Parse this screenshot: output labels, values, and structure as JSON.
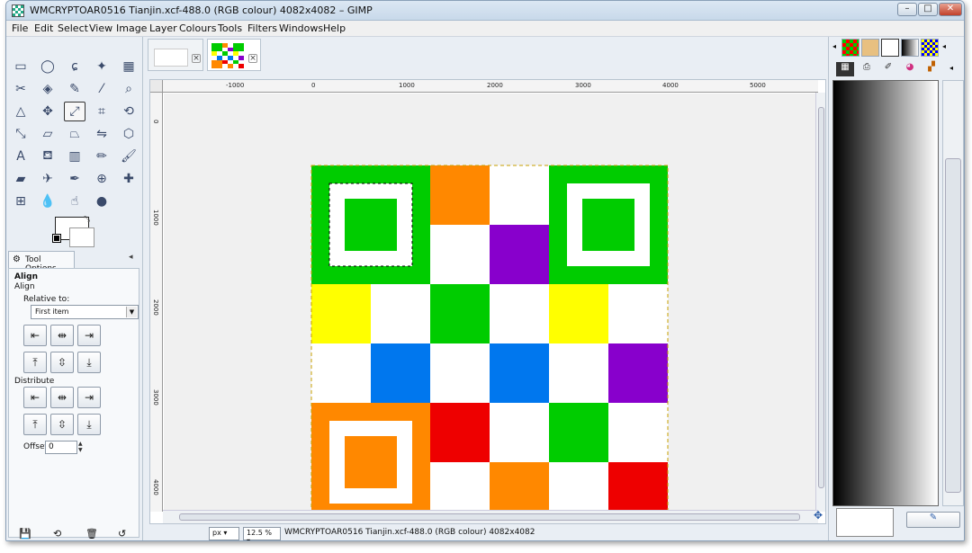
{
  "window": {
    "title": "WMCRYPTOAR0516 Tianjin.xcf-488.0 (RGB colour) 4082x4082 – GIMP",
    "min_label": "–",
    "max_label": "□",
    "close_label": "✕"
  },
  "menu": {
    "items": [
      "File",
      "Edit",
      "Select",
      "View",
      "Image",
      "Layer",
      "Colours",
      "Tools",
      "Filters",
      "Windows",
      "Help"
    ]
  },
  "toolbox": {
    "tools": [
      {
        "name": "rect-select",
        "glyph": "▭"
      },
      {
        "name": "ellipse-select",
        "glyph": "◯"
      },
      {
        "name": "free-select",
        "glyph": "ɕ"
      },
      {
        "name": "fuzzy-select",
        "glyph": "✦"
      },
      {
        "name": "select-by-color",
        "glyph": "▦"
      },
      {
        "name": "scissors-select",
        "glyph": "✂"
      },
      {
        "name": "foreground-select",
        "glyph": "◈"
      },
      {
        "name": "paths",
        "glyph": "✎"
      },
      {
        "name": "color-picker",
        "glyph": "⁄"
      },
      {
        "name": "zoom",
        "glyph": "⌕"
      },
      {
        "name": "measure",
        "glyph": "△"
      },
      {
        "name": "move",
        "glyph": "✥"
      },
      {
        "name": "align",
        "glyph": "⤢"
      },
      {
        "name": "crop",
        "glyph": "⌗"
      },
      {
        "name": "rotate",
        "glyph": "⟲"
      },
      {
        "name": "scale",
        "glyph": "⤡"
      },
      {
        "name": "shear",
        "glyph": "▱"
      },
      {
        "name": "perspective",
        "glyph": "⏢"
      },
      {
        "name": "flip",
        "glyph": "⇋"
      },
      {
        "name": "cage",
        "glyph": "⬡"
      },
      {
        "name": "text",
        "glyph": "A"
      },
      {
        "name": "bucket-fill",
        "glyph": "⛾"
      },
      {
        "name": "blend",
        "glyph": "▥"
      },
      {
        "name": "pencil",
        "glyph": "✏"
      },
      {
        "name": "paintbrush",
        "glyph": "🖌"
      },
      {
        "name": "eraser",
        "glyph": "▰"
      },
      {
        "name": "airbrush",
        "glyph": "✈"
      },
      {
        "name": "ink",
        "glyph": "✒"
      },
      {
        "name": "clone",
        "glyph": "⊕"
      },
      {
        "name": "heal",
        "glyph": "✚"
      },
      {
        "name": "perspective-clone",
        "glyph": "⊞"
      },
      {
        "name": "blur",
        "glyph": "💧"
      },
      {
        "name": "smudge",
        "glyph": "☝"
      },
      {
        "name": "dodge-burn",
        "glyph": "●"
      }
    ],
    "tool_options_tab": "Tool Options",
    "align_heading": "Align",
    "align_subheading": "Align",
    "relative_to_label": "Relative to:",
    "relative_to_value": "First item",
    "distribute_label": "Distribute",
    "offset_label": "Offset:",
    "offset_value": "0"
  },
  "tabs": [
    {
      "label": "blank image"
    },
    {
      "label": "Tianjin image"
    }
  ],
  "ruler": {
    "ticks": [
      "-1000",
      "0",
      "1000",
      "2000",
      "3000",
      "4000",
      "5000"
    ],
    "vticks": [
      "0",
      "1000",
      "2000",
      "3000",
      "4000"
    ]
  },
  "status": {
    "unit": "px",
    "zoom": "12.5 %",
    "text": "WMCRYPTOAR0516 Tianjin.xcf-488.0 (RGB colour) 4082x4082"
  },
  "colors": {
    "green": "#00cc00",
    "orange": "#ff8800",
    "purple": "#8800cc",
    "yellow": "#ffff00",
    "blue": "#0077ee",
    "red": "#ee0000",
    "white": "#ffffff"
  },
  "image_grid": [
    [
      "G",
      "G",
      "O",
      "W",
      "G",
      "G"
    ],
    [
      "G",
      "G",
      "W",
      "P",
      "G",
      "G"
    ],
    [
      "Y",
      "W",
      "G",
      "W",
      "Y",
      "W"
    ],
    [
      "W",
      "B",
      "W",
      "B",
      "W",
      "P"
    ],
    [
      "O",
      "O",
      "R",
      "W",
      "G",
      "W"
    ],
    [
      "O",
      "O",
      "W",
      "O",
      "W",
      "R"
    ]
  ]
}
